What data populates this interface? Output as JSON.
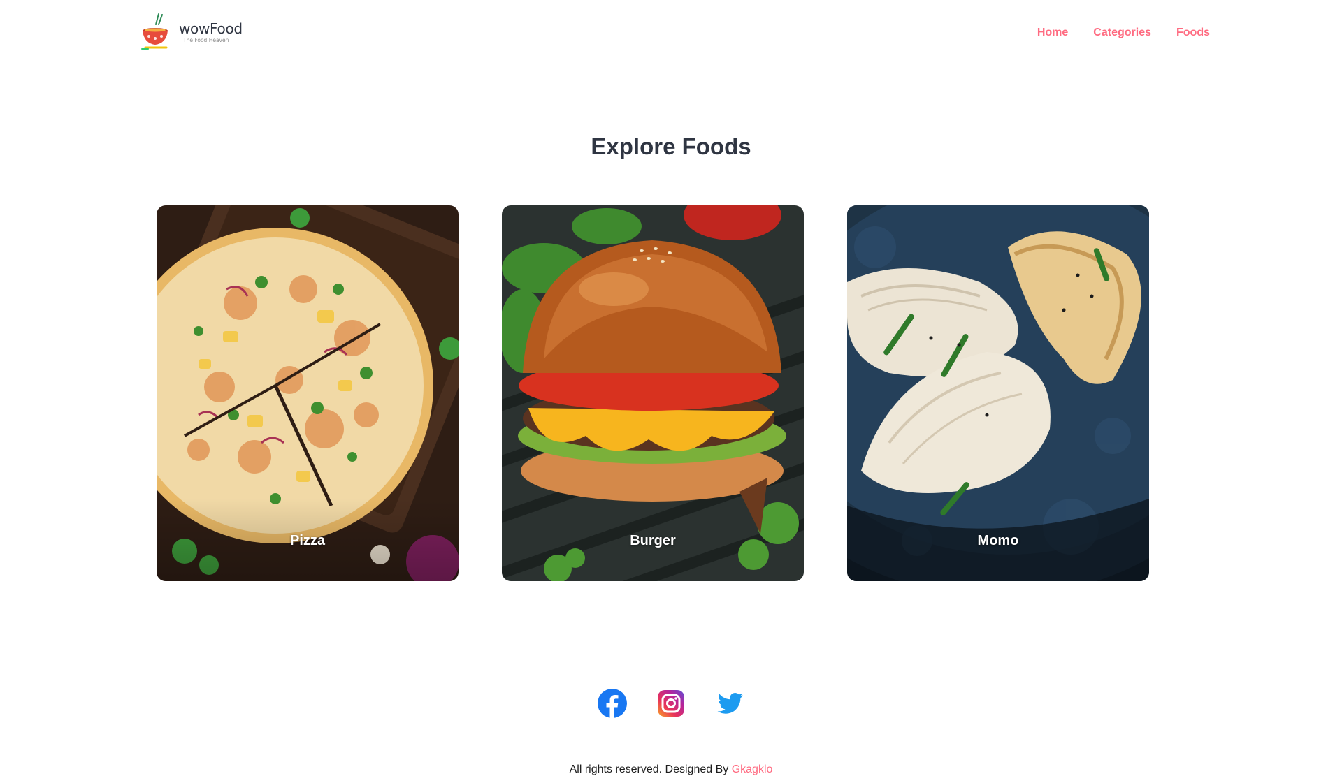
{
  "brand": {
    "name": "wowFood",
    "tagline": "The Food Heaven"
  },
  "nav": {
    "items": [
      {
        "label": "Home"
      },
      {
        "label": "Categories"
      },
      {
        "label": "Foods"
      }
    ]
  },
  "main": {
    "title": "Explore Foods",
    "foods": [
      {
        "label": "Pizza",
        "icon": "pizza-image"
      },
      {
        "label": "Burger",
        "icon": "burger-image"
      },
      {
        "label": "Momo",
        "icon": "momo-image"
      }
    ]
  },
  "footer": {
    "social": [
      {
        "name": "facebook-icon"
      },
      {
        "name": "instagram-icon"
      },
      {
        "name": "twitter-icon"
      }
    ],
    "copyright_text": "All rights reserved. Designed By",
    "designer": "Gkagklo"
  },
  "colors": {
    "accent": "#ff6b81",
    "heading": "#2f3542",
    "facebook": "#1877f2",
    "twitter": "#1da1f2"
  }
}
